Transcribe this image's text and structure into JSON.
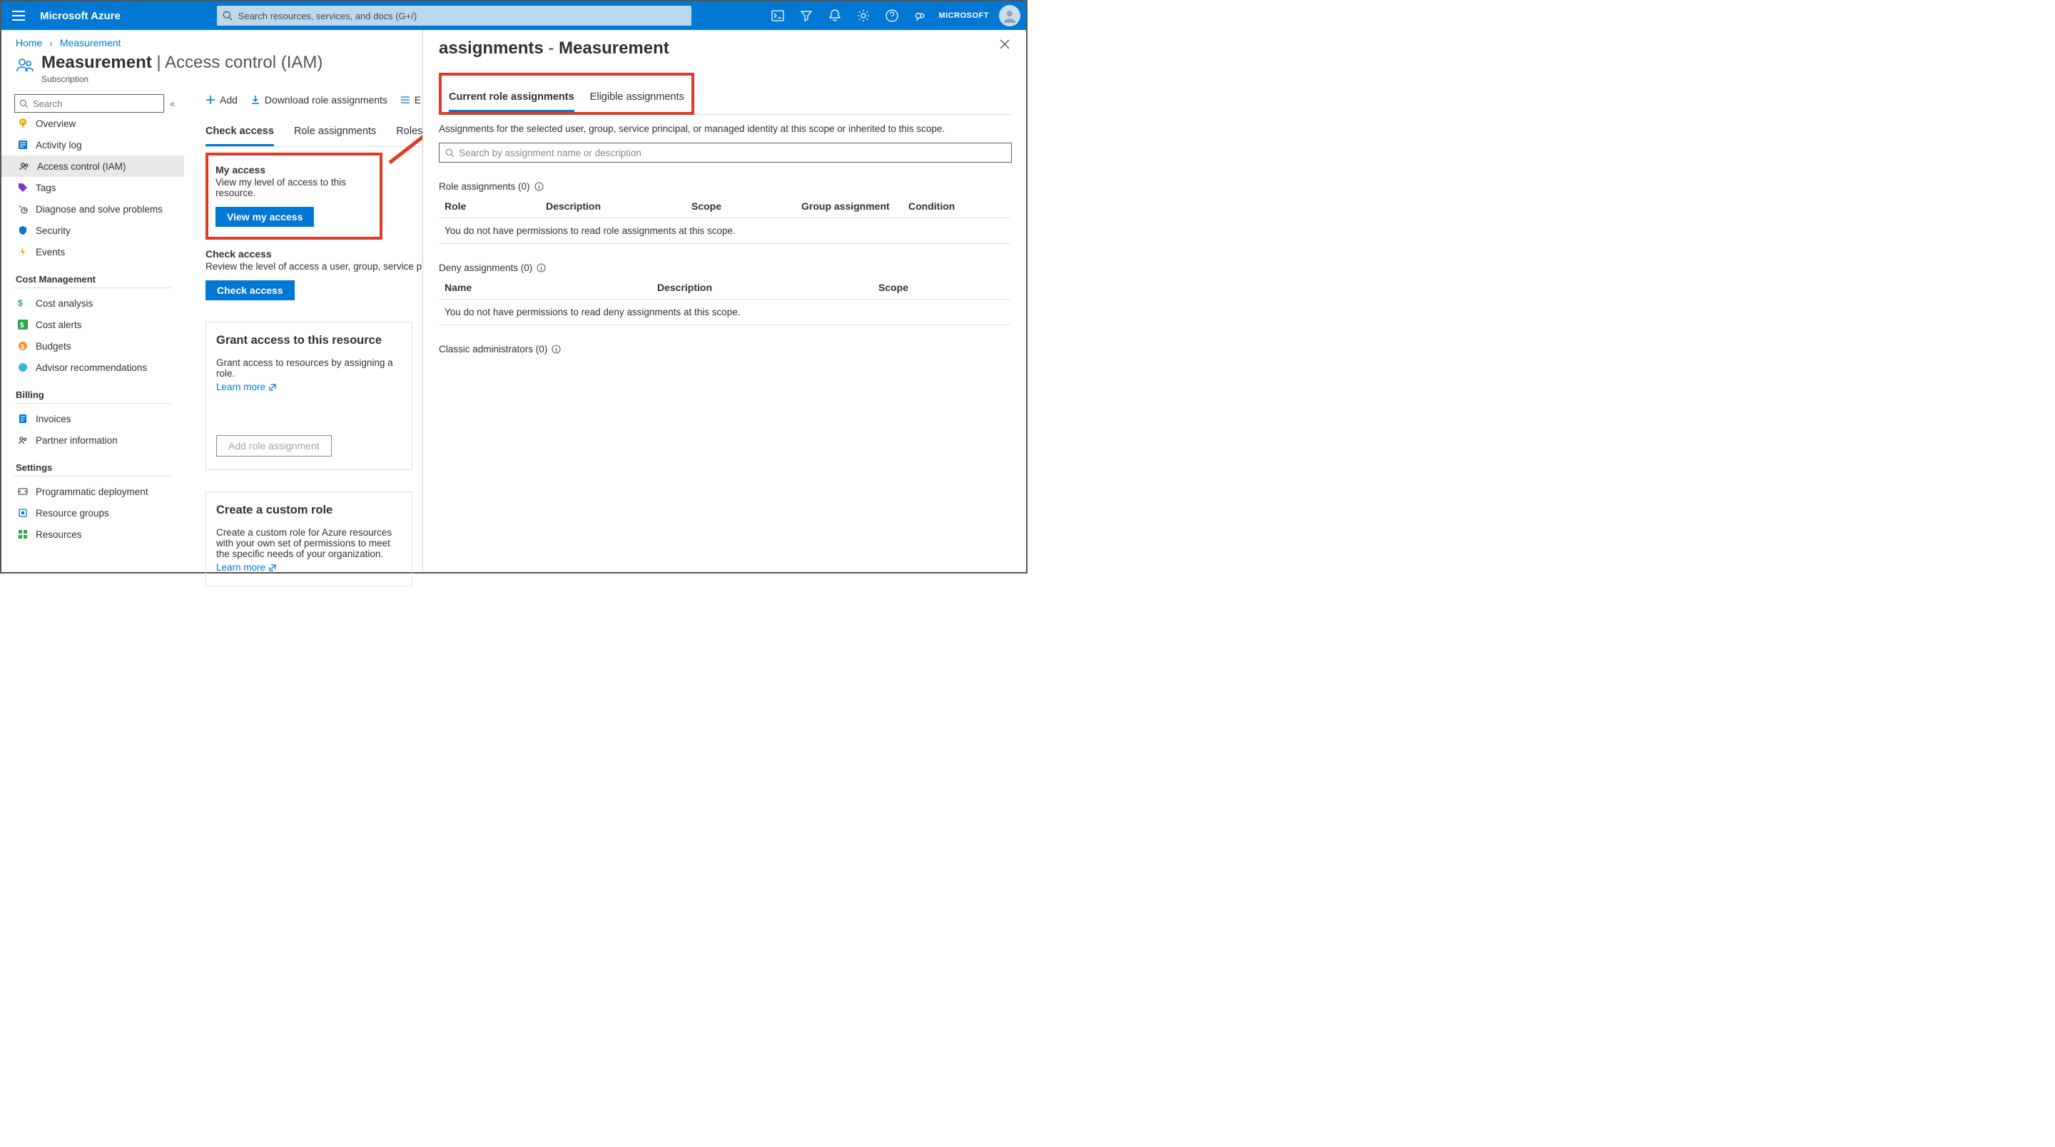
{
  "topbar": {
    "brand": "Microsoft Azure",
    "search_placeholder": "Search resources, services, and docs (G+/)",
    "tenant": "MICROSOFT"
  },
  "breadcrumb": {
    "home": "Home",
    "current": "Measurement"
  },
  "page": {
    "title": "Measurement",
    "sep": " | ",
    "subtitle": "Access control (IAM)",
    "resource_type": "Subscription"
  },
  "leftnav": {
    "search_placeholder": "Search",
    "items_top": [
      "Overview",
      "Activity log",
      "Access control (IAM)",
      "Tags",
      "Diagnose and solve problems",
      "Security",
      "Events"
    ],
    "group_cost": "Cost Management",
    "items_cost": [
      "Cost analysis",
      "Cost alerts",
      "Budgets",
      "Advisor recommendations"
    ],
    "group_billing": "Billing",
    "items_billing": [
      "Invoices",
      "Partner information"
    ],
    "group_settings": "Settings",
    "items_settings": [
      "Programmatic deployment",
      "Resource groups",
      "Resources"
    ]
  },
  "toolbar": {
    "add": "Add",
    "download": "Download role assignments",
    "edit": "E"
  },
  "tabs": {
    "check": "Check access",
    "role_assignments": "Role assignments",
    "roles": "Roles"
  },
  "my_access": {
    "title": "My access",
    "desc": "View my level of access to this resource.",
    "button": "View my access"
  },
  "check_access": {
    "title": "Check access",
    "desc": "Review the level of access a user, group, service prin",
    "button": "Check access"
  },
  "grant_card": {
    "title": "Grant access to this resource",
    "desc": "Grant access to resources by assigning a role.",
    "learn": "Learn more",
    "button": "Add role assignment"
  },
  "custom_card": {
    "title": "Create a custom role",
    "desc": "Create a custom role for Azure resources with your own set of permissions to meet the specific needs of your organization.",
    "learn": "Learn more"
  },
  "rightpane": {
    "title_left": "assignments",
    "title_sep": "  -  ",
    "title_right": "Measurement",
    "tab_current": "Current role assignments",
    "tab_eligible": "Eligible assignments",
    "desc": "Assignments for the selected user, group, service principal, or managed identity at this scope or inherited to this scope.",
    "search_placeholder": "Search by assignment name or description",
    "role_section": "Role assignments (0)",
    "role_cols": {
      "c1": "Role",
      "c2": "Description",
      "c3": "Scope",
      "c4": "Group assignment",
      "c5": "Condition"
    },
    "role_empty": "You do not have permissions to read role assignments at this scope.",
    "deny_section": "Deny assignments (0)",
    "deny_cols": {
      "c1": "Name",
      "c2": "Description",
      "c3": "Scope"
    },
    "deny_empty": "You do not have permissions to read deny assignments at this scope.",
    "classic_section": "Classic administrators (0)"
  }
}
